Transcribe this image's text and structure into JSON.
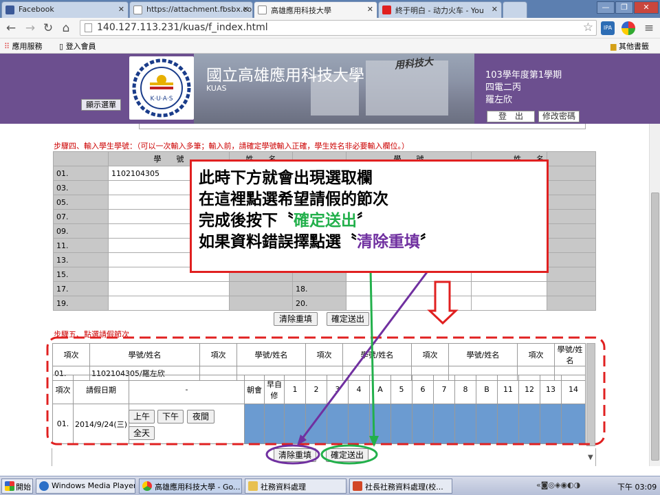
{
  "browser": {
    "tabs": [
      {
        "label": "Facebook",
        "color": "#3b5998"
      },
      {
        "label": "https://attachment.fbsbx.com/",
        "color": "#888888"
      },
      {
        "label": "高雄應用科技大學",
        "color": "#4a6fa5"
      },
      {
        "label": "終于明白 - 动力火车 - You",
        "color": "#e02020"
      }
    ],
    "url": "140.127.113.231/kuas/f_index.html",
    "bookmarks": {
      "apps": "應用服務",
      "login": "登入會員",
      "other": "其他書籤"
    },
    "window_controls": {
      "minimize": "—",
      "restore": "❐",
      "close": "✕"
    }
  },
  "header": {
    "menu_button": "顯示選單",
    "school_name": "國立高雄應用科技大學",
    "school_abbr": "KUAS",
    "photo_text": "用科技大",
    "semester": "103學年度第1學期",
    "class_name": "四電二丙",
    "student_name": "羅左欣",
    "logout": "登　出",
    "change_password": "修改密碼"
  },
  "step4": {
    "title": "步驟四、輸入學生學號：（可以一次輸入多筆；輸入前，請確定學號輸入正確，學生姓名非必要輸入欄位。）",
    "headers": [
      "學　　號",
      "姓　　名",
      "學　　號",
      "姓　　名"
    ],
    "rows": [
      {
        "no": "01.",
        "id": "1102104305",
        "no2": ""
      },
      {
        "no": "03.",
        "id": "",
        "no2": ""
      },
      {
        "no": "05.",
        "id": "",
        "no2": ""
      },
      {
        "no": "07.",
        "id": "",
        "no2": ""
      },
      {
        "no": "09.",
        "id": "",
        "no2": ""
      },
      {
        "no": "11.",
        "id": "",
        "no2": ""
      },
      {
        "no": "13.",
        "id": "",
        "no2": ""
      },
      {
        "no": "15.",
        "id": "",
        "no2": ""
      },
      {
        "no": "17.",
        "id": "",
        "no2": "18."
      },
      {
        "no": "19.",
        "id": "",
        "no2": "20."
      }
    ],
    "clear_button": "清除重填",
    "submit_button": "確定送出"
  },
  "step5": {
    "title": "步驟五、點選請假節次",
    "summary_headers": [
      "項次",
      "學號/姓名",
      "項次",
      "學號/姓名",
      "項次",
      "學號/姓名",
      "項次",
      "學號/姓名",
      "項次",
      "學號/姓名"
    ],
    "summary_row": [
      "01.",
      "1102104305/羅左欣"
    ],
    "period_headers": {
      "item": "項次",
      "date": "請假日期",
      "dash": "-",
      "morning": "朝會",
      "early": "早自修",
      "periods": [
        "1",
        "2",
        "3",
        "4",
        "A",
        "5",
        "6",
        "7",
        "8",
        "B",
        "11",
        "12",
        "13",
        "14"
      ]
    },
    "row": {
      "no": "01.",
      "date": "2014/9/24(三)",
      "am": "上午",
      "pm": "下午",
      "night": "夜間",
      "all_day": "全天"
    },
    "clear_button": "清除重填",
    "submit_button": "確定送出"
  },
  "annotation": {
    "line1": "此時下方就會出現選取欄",
    "line2": "在這裡點選希望請假的節次",
    "line3_prefix": "完成後按下〝",
    "line3_highlight": "確定送出",
    "line3_suffix": "〞",
    "line4_prefix": "如果資料錯誤擇點選〝",
    "line4_highlight": "清除重填",
    "line4_suffix": "〞",
    "colors": {
      "border": "#e02020",
      "green": "#22b04b",
      "purple": "#7030a0"
    }
  },
  "taskbar": {
    "start": "開始",
    "items": [
      "Windows Media Player",
      "高雄應用科技大學 - Go...",
      "社務資料處理",
      "社長社務資料處理(校..."
    ],
    "clock": "下午 03:09"
  }
}
